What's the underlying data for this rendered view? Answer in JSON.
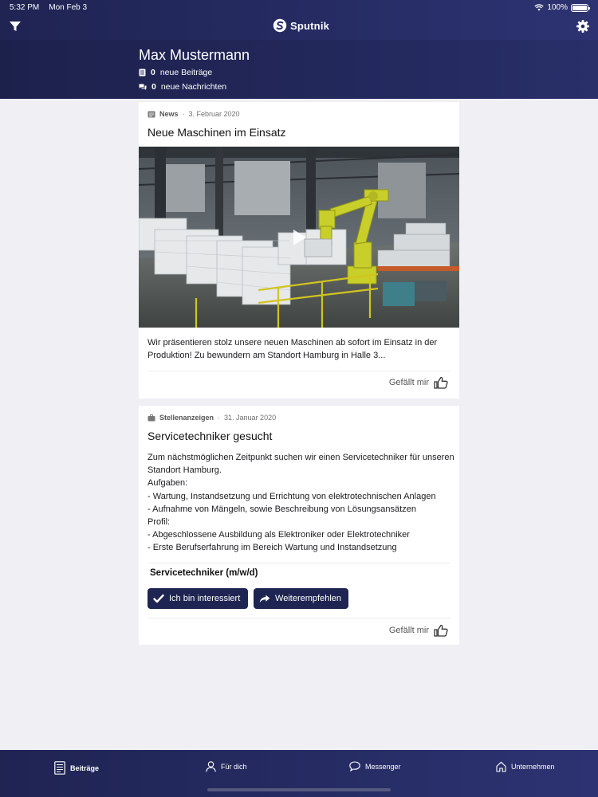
{
  "status_bar": {
    "time": "5:32 PM",
    "date": "Mon Feb 3",
    "battery": "100%"
  },
  "header": {
    "brand": "Sputnik"
  },
  "profile": {
    "name": "Max Mustermann",
    "posts_count": "0",
    "posts_label": "neue Beiträge",
    "messages_count": "0",
    "messages_label": "neue Nachrichten"
  },
  "posts": [
    {
      "category": "News",
      "separator": "·",
      "date": "3. Februar 2020",
      "title": "Neue Maschinen im Einsatz",
      "body": "Wir präsentieren stolz unsere neuen Maschinen ab sofort im Einsatz in der Produktion! Zu bewundern am Standort Hamburg in Halle 3...",
      "like_label": "Gefällt mir"
    },
    {
      "category": "Stellenanzeigen",
      "separator": "·",
      "date": "31. Januar 2020",
      "title": "Servicetechniker gesucht",
      "body": "Zum nächstmöglichen Zeitpunkt suchen wir einen Servicetechniker für unseren Standort Hamburg.\nAufgaben:\n- Wartung, Instandsetzung und Errichtung von elektrotechnischen Anlagen\n- Aufnahme von Mängeln, sowie Beschreibung von Lösungsansätzen\nProfil:\n- Abgeschlossene Ausbildung als Elektroniker oder Elektrotechniker\n- Erste Berufserfahrung im Bereich Wartung und Instandsetzung",
      "job_title": "Servicetechniker (m/w/d)",
      "interested_label": "Ich bin interessiert",
      "recommend_label": "Weiterempfehlen",
      "like_label": "Gefällt mir"
    }
  ],
  "tabs": [
    {
      "label": "Beiträge",
      "icon": "document-icon",
      "active": true
    },
    {
      "label": "Für dich",
      "icon": "person-icon",
      "active": false
    },
    {
      "label": "Messenger",
      "icon": "chat-bubble-icon",
      "active": false
    },
    {
      "label": "Unternehmen",
      "icon": "home-icon",
      "active": false
    }
  ],
  "colors": {
    "header": "#262c63",
    "button": "#1f2552",
    "background": "#efeff4",
    "machine": "#c9cf2a"
  }
}
